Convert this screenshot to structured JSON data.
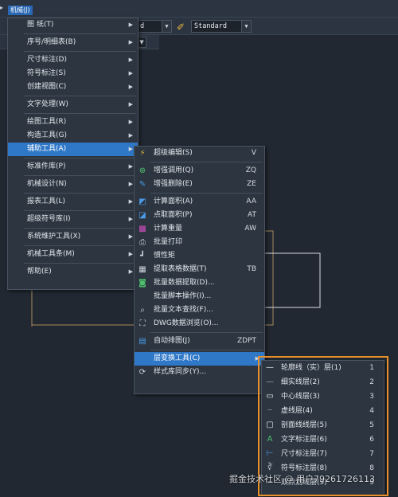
{
  "menubar": {
    "item": "机械(J)"
  },
  "toolbar": {
    "combo1": "d",
    "textstyle": "Standard"
  },
  "main_menu": [
    {
      "label": "图    纸(T)",
      "sub": true
    },
    {
      "sep": true
    },
    {
      "label": "序号/明细表(B)",
      "sub": true
    },
    {
      "sep": true
    },
    {
      "label": "尺寸标注(D)",
      "sub": true
    },
    {
      "label": "符号标注(S)",
      "sub": true
    },
    {
      "label": "创建视图(C)",
      "sub": true
    },
    {
      "sep": true
    },
    {
      "label": "文字处理(W)",
      "sub": true
    },
    {
      "sep": true
    },
    {
      "label": "绘图工具(R)",
      "sub": true
    },
    {
      "label": "构造工具(G)",
      "sub": true
    },
    {
      "label": "辅助工具(A)",
      "sub": true,
      "highlight": true
    },
    {
      "sep": true
    },
    {
      "label": "标准件库(P)",
      "sub": true
    },
    {
      "sep": true
    },
    {
      "label": "机械设计(N)",
      "sub": true
    },
    {
      "sep": true
    },
    {
      "label": "报表工具(L)",
      "sub": true
    },
    {
      "sep": true
    },
    {
      "label": "超级符号库(I)",
      "sub": true
    },
    {
      "sep": true
    },
    {
      "label": "系统维护工具(X)",
      "sub": true
    },
    {
      "sep": true
    },
    {
      "label": "机械工具条(M)",
      "sub": true
    },
    {
      "sep": true
    },
    {
      "label": "帮助(E)",
      "sub": true
    }
  ],
  "aux_menu": [
    {
      "label": "超级编辑(S)",
      "key": "V",
      "icon": "super-edit-icon"
    },
    {
      "sep": true
    },
    {
      "label": "增强调用(Q)",
      "key": "ZQ",
      "icon": "enhanced-call-icon"
    },
    {
      "label": "增强删除(E)",
      "key": "ZE",
      "icon": "enhanced-delete-icon"
    },
    {
      "sep": true
    },
    {
      "label": "计算面积(A)",
      "key": "AA",
      "icon": "area-calc-icon"
    },
    {
      "label": "点取面积(P)",
      "key": "AT",
      "icon": "pick-area-icon"
    },
    {
      "label": "计算重量",
      "key": "AW",
      "icon": "weight-calc-icon"
    },
    {
      "label": "批量打印",
      "key": "",
      "icon": "batch-print-icon"
    },
    {
      "label": "惯性矩",
      "key": "",
      "icon": "inertia-icon"
    },
    {
      "label": "提取表格数据(T)",
      "key": "TB",
      "icon": "table-extract-icon"
    },
    {
      "label": "批量数据提取(D)...",
      "key": "",
      "icon": "batch-data-icon"
    },
    {
      "label": "批量脚本操作(I)...",
      "key": "",
      "icon": ""
    },
    {
      "label": "批量文本查找(F)...",
      "key": "",
      "icon": "text-find-icon"
    },
    {
      "label": "DWG数据浏览(O)...",
      "key": "",
      "icon": "dwg-browse-icon"
    },
    {
      "sep": true
    },
    {
      "label": "自动排图(J)",
      "key": "ZDPT",
      "icon": "auto-layout-icon"
    },
    {
      "sep": true
    },
    {
      "label": "层变换工具(C)",
      "key": "",
      "icon": "",
      "sub": true,
      "highlight": true
    },
    {
      "label": "样式库同步(Y)...",
      "key": "",
      "icon": "style-sync-icon"
    }
  ],
  "layer_menu": [
    {
      "label": "轮廓线（实）层(1)",
      "num": "1",
      "icon": "solid-line-icon"
    },
    {
      "label": "细实线层(2)",
      "num": "2",
      "icon": "thin-line-icon"
    },
    {
      "label": "中心线层(3)",
      "num": "3",
      "icon": "center-line-icon"
    },
    {
      "label": "虚线层(4)",
      "num": "4",
      "icon": "dashed-line-icon"
    },
    {
      "label": "剖面线线层(5)",
      "num": "5",
      "icon": "hatch-line-icon"
    },
    {
      "label": "文字标注层(6)",
      "num": "6",
      "icon": "text-layer-icon"
    },
    {
      "label": "尺寸标注层(7)",
      "num": "7",
      "icon": "dimension-layer-icon"
    },
    {
      "label": "符号标注层(8)",
      "num": "8",
      "icon": "symbol-layer-icon"
    },
    {
      "label": "双点划线层(9)",
      "num": "9",
      "icon": "double-dash-icon"
    }
  ],
  "watermark": "掘金技术社区 @ 用户79261726113",
  "colors": {
    "highlight": "#2f78c7",
    "menu_bg": "#2c3540",
    "orange_box": "#e8912c"
  }
}
